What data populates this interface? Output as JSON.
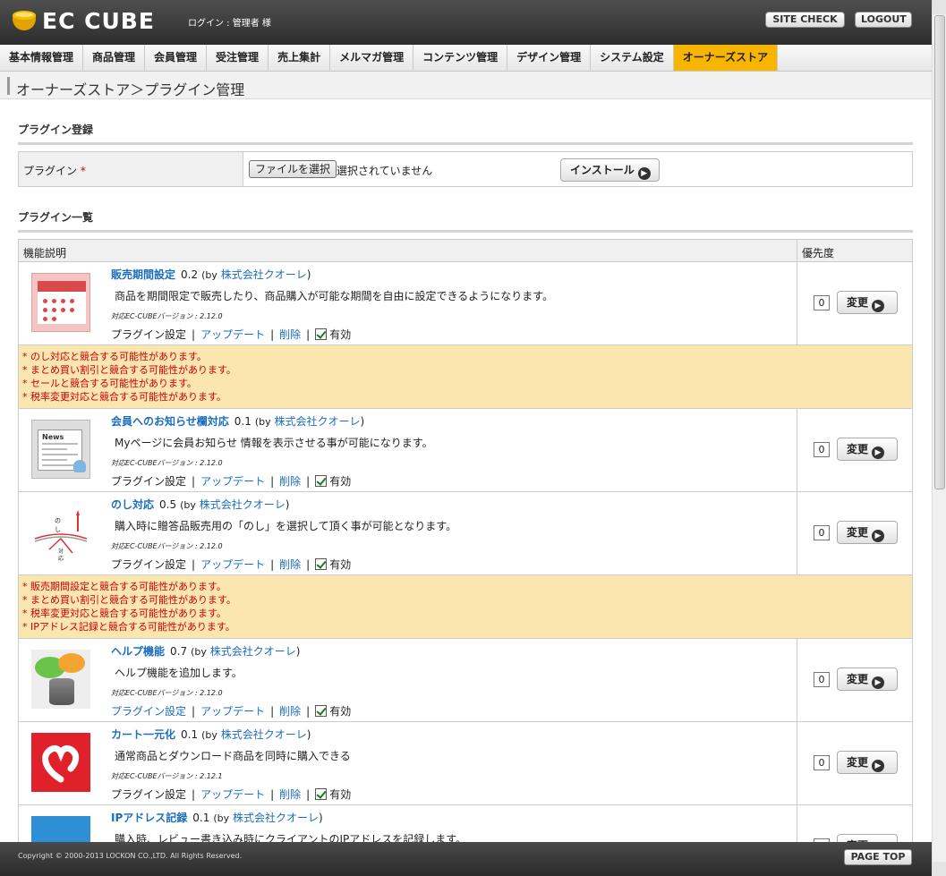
{
  "header": {
    "logo_text": "EC CUBE",
    "login_text": "ログイン : 管理者 様",
    "site_check": "SITE CHECK",
    "logout": "LOGOUT"
  },
  "nav": {
    "items": [
      {
        "label": "基本情報管理"
      },
      {
        "label": "商品管理"
      },
      {
        "label": "会員管理"
      },
      {
        "label": "受注管理"
      },
      {
        "label": "売上集計"
      },
      {
        "label": "メルマガ管理"
      },
      {
        "label": "コンテンツ管理"
      },
      {
        "label": "デザイン管理"
      },
      {
        "label": "システム設定"
      },
      {
        "label": "オーナーズストア",
        "active": true
      }
    ]
  },
  "page_title": "オーナーズストア＞プラグイン管理",
  "register": {
    "section_title": "プラグイン登録",
    "label": "プラグイン",
    "required_mark": "*",
    "file_button": "ファイルを選択",
    "file_status": "選択されていません",
    "install_button": "インストール"
  },
  "list": {
    "section_title": "プラグイン一覧",
    "col_desc": "機能説明",
    "col_priority": "優先度",
    "by_label": "(by",
    "close_paren": ")",
    "change_label": "変更",
    "settings_label": "プラグイン設定",
    "update_label": "アップデート",
    "delete_label": "削除",
    "enabled_label": "有効",
    "separator": "|"
  },
  "plugins": [
    {
      "name": "販売期間設定",
      "version": "0.2",
      "author": "株式会社クオーレ",
      "description": "商品を期間限定で販売したり、商品購入が可能な期間を自由に設定できるようになります。",
      "compat": "対応EC-CUBEバージョン : 2.12.0",
      "priority": "0",
      "settings_link": false,
      "icon": "calendar-icon",
      "warnings": [
        "* のし対応と競合する可能性があります。",
        "* まとめ買い割引と競合する可能性があります。",
        "* セールと競合する可能性があります。",
        "* 税率変更対応と競合する可能性があります。"
      ]
    },
    {
      "name": "会員へのお知らせ欄対応",
      "version": "0.1",
      "author": "株式会社クオーレ",
      "description": "Myページに会員お知らせ 情報を表示させる事が可能になります。",
      "compat": "対応EC-CUBEバージョン : 2.12.0",
      "priority": "0",
      "settings_link": false,
      "icon": "news-icon",
      "warnings": []
    },
    {
      "name": "のし対応",
      "version": "0.5",
      "author": "株式会社クオーレ",
      "description": "購入時に贈答品販売用の「のし」を選択して頂く事が可能となります。",
      "compat": "対応EC-CUBEバージョン : 2.12.0",
      "priority": "0",
      "settings_link": false,
      "icon": "noshi-icon",
      "warnings": [
        "* 販売期間設定と競合する可能性があります。",
        "* まとめ買い割引と競合する可能性があります。",
        "* 税率変更対応と競合する可能性があります。",
        "* IPアドレス記録と競合する可能性があります。"
      ]
    },
    {
      "name": "ヘルプ機能",
      "version": "0.7",
      "author": "株式会社クオーレ",
      "description": "ヘルプ機能を追加します。",
      "compat": "対応EC-CUBEバージョン : 2.12.0",
      "priority": "0",
      "settings_link": true,
      "icon": "help-icon",
      "warnings": []
    },
    {
      "name": "カート一元化",
      "version": "0.1",
      "author": "株式会社クオーレ",
      "description": "通常商品とダウンロード商品を同時に購入できる",
      "compat": "対応EC-CUBEバージョン : 2.12.1",
      "priority": "0",
      "settings_link": false,
      "icon": "cart-icon",
      "warnings": []
    },
    {
      "name": "IPアドレス記録",
      "version": "0.1",
      "author": "株式会社クオーレ",
      "description": "購入時、レビュー書き込み時にクライアントのIPアドレスを記録します。",
      "compat": "",
      "priority": "0",
      "settings_link": false,
      "icon": "ip-icon",
      "warnings": []
    }
  ],
  "footer": {
    "copyright": "Copyright © 2000-2013 LOCKON CO.,LTD. All Rights Reserved.",
    "page_top": "PAGE TOP"
  },
  "colors": {
    "accent": "#f7b500",
    "link": "#1a6dbf",
    "warning_bg": "#fbe6b0",
    "warning_text": "#cc0000"
  }
}
